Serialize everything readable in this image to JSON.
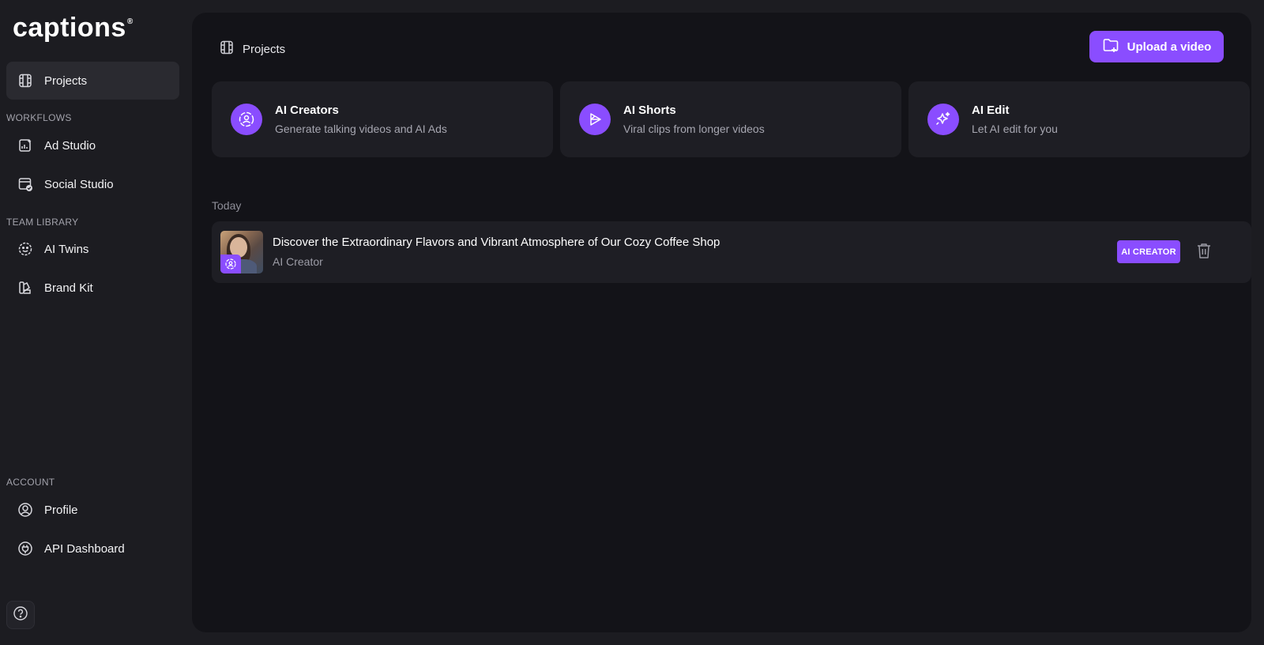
{
  "app": {
    "logo_text": "captions",
    "logo_mark": "®"
  },
  "sidebar": {
    "projects_label": "Projects",
    "workflows_heading": "WORKFLOWS",
    "workflows": [
      {
        "label": "Ad Studio",
        "icon": "ad-studio-icon"
      },
      {
        "label": "Social Studio",
        "icon": "calendar-check-icon"
      }
    ],
    "team_heading": "TEAM LIBRARY",
    "team": [
      {
        "label": "AI Twins",
        "icon": "smiley-face-icon"
      },
      {
        "label": "Brand Kit",
        "icon": "brand-kit-icon"
      }
    ],
    "account_heading": "ACCOUNT",
    "account": [
      {
        "label": "Profile",
        "icon": "user-circle-icon"
      },
      {
        "label": "API Dashboard",
        "icon": "plug-icon"
      }
    ],
    "help_icon": "question-circle-icon"
  },
  "header": {
    "breadcrumb": "Projects",
    "upload_label": "Upload a video"
  },
  "cards": [
    {
      "title": "AI Creators",
      "subtitle": "Generate talking videos and AI Ads",
      "icon": "ai-creator-icon"
    },
    {
      "title": "AI Shorts",
      "subtitle": "Viral clips from longer videos",
      "icon": "play-shorts-icon"
    },
    {
      "title": "AI Edit",
      "subtitle": "Let AI edit for you",
      "icon": "sparkle-icon"
    }
  ],
  "projects": {
    "group_label": "Today",
    "items": [
      {
        "title": "Discover the Extraordinary Flavors and Vibrant Atmosphere of Our Cozy Coffee Shop",
        "subtitle": "AI Creator",
        "tag": "AI CREATOR"
      }
    ]
  },
  "colors": {
    "accent": "#8a4dff",
    "background": "#1c1c21",
    "panel": "#131318",
    "card": "#1e1e24"
  }
}
